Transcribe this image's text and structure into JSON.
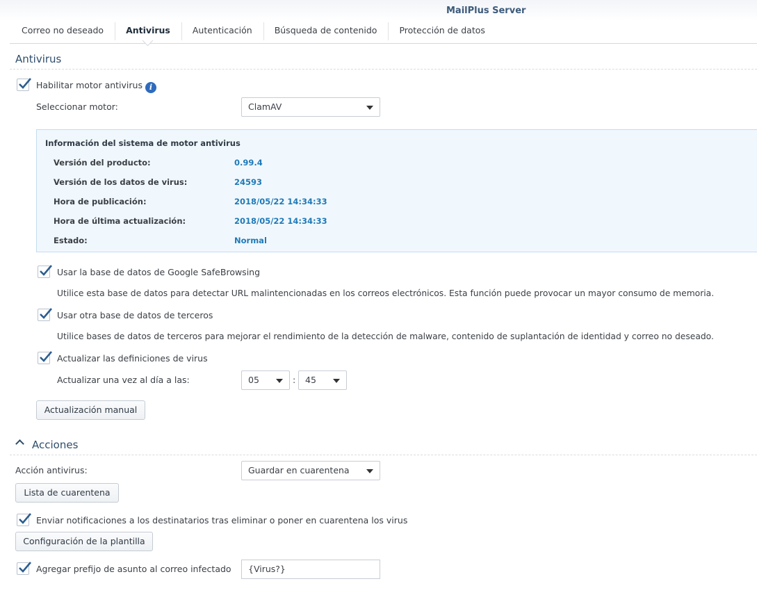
{
  "app": {
    "title": "MailPlus Server"
  },
  "tabs": [
    {
      "label": "Correo no deseado"
    },
    {
      "label": "Antivirus"
    },
    {
      "label": "Autenticación"
    },
    {
      "label": "Búsqueda de contenido"
    },
    {
      "label": "Protección de datos"
    }
  ],
  "antivirus": {
    "section_title": "Antivirus",
    "enable_label": "Habilitar motor antivirus",
    "enable_checked": true,
    "engine_label": "Seleccionar motor:",
    "engine_value": "ClamAV",
    "info": {
      "title": "Información del sistema de motor antivirus",
      "rows": [
        {
          "label": "Versión del producto:",
          "value": "0.99.4"
        },
        {
          "label": "Versión de los datos de virus:",
          "value": "24593"
        },
        {
          "label": "Hora de publicación:",
          "value": "2018/05/22 14:34:33"
        },
        {
          "label": "Hora de última actualización:",
          "value": "2018/05/22 14:34:33"
        },
        {
          "label": "Estado:",
          "value": "Normal"
        }
      ]
    },
    "safebrowsing_label": "Usar la base de datos de Google SafeBrowsing",
    "safebrowsing_checked": true,
    "safebrowsing_desc": "Utilice esta base de datos para detectar URL malintencionadas en los correos electrónicos. Esta función puede provocar un mayor consumo de memoria.",
    "thirdparty_label": "Usar otra base de datos de terceros",
    "thirdparty_checked": true,
    "thirdparty_desc": "Utilice bases de datos de terceros para mejorar el rendimiento de la detección de malware, contenido de suplantación de identidad y correo no deseado.",
    "update_label": "Actualizar las definiciones de virus",
    "update_checked": true,
    "update_time_label": "Actualizar una vez al día a las:",
    "update_hour": "05",
    "time_separator": ":",
    "update_minute": "45",
    "manual_update_button": "Actualización manual"
  },
  "actions": {
    "section_title": "Acciones",
    "action_label": "Acción antivirus:",
    "action_value": "Guardar en cuarentena",
    "quarantine_button": "Lista de cuarentena",
    "notify_label": "Enviar notificaciones a los destinatarios tras eliminar o poner en cuarentena los virus",
    "notify_checked": true,
    "template_button": "Configuración de la plantilla",
    "prefix_label": "Agregar prefijo de asunto al correo infectado",
    "prefix_checked": true,
    "prefix_value": "{Virus?}"
  },
  "colors": {
    "accent": "#2f6bbd",
    "value_blue": "#1f7ab8",
    "section_title": "#2e4d6b",
    "info_bg": "#f1f8fd"
  },
  "icons": {
    "checkbox": "checkmark-icon",
    "info": "info-icon",
    "dropdown": "caret-down-icon",
    "collapse": "chevron-up-icon"
  }
}
